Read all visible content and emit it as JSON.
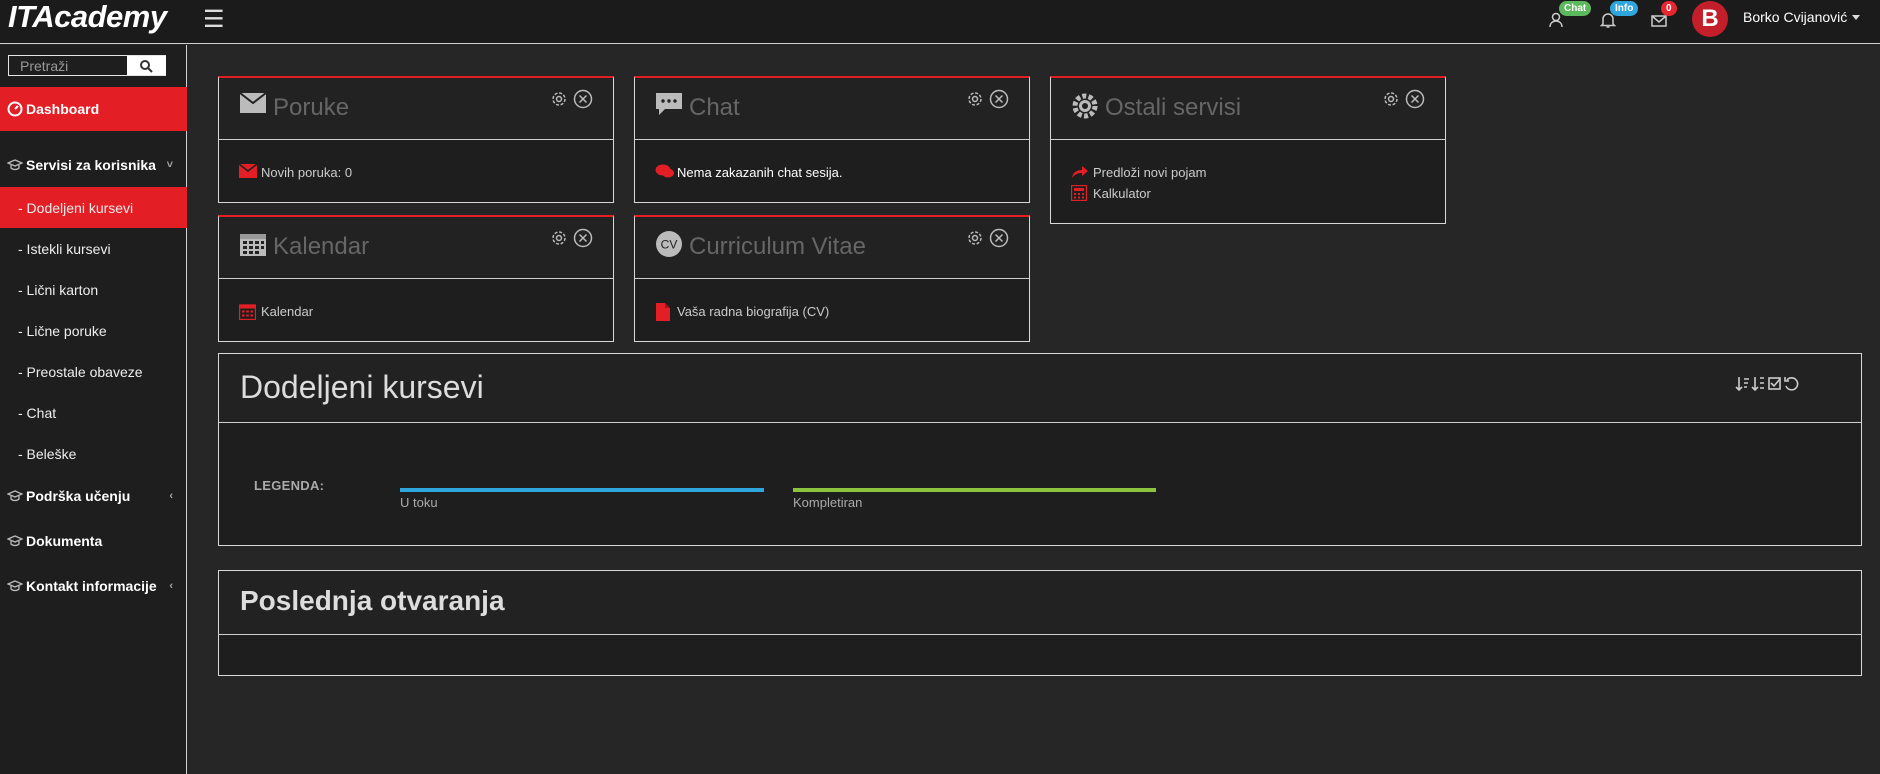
{
  "app": {
    "title": "ITAcademy"
  },
  "topbar": {
    "menu_icon": "hamburger-icon",
    "chat_badge": "Chat",
    "info_badge": "Info",
    "messages_badge": "0",
    "avatar_letter": "B",
    "username": "Borko Cvijanović"
  },
  "sidebar": {
    "search_placeholder": "Pretraži",
    "items": [
      {
        "label": "Dashboard",
        "icon": "dashboard-icon"
      },
      {
        "label": "Servisi za korisnika",
        "icon": "graduation-cap-icon"
      },
      {
        "label": "- Dodeljeni kursevi"
      },
      {
        "label": "- Istekli kursevi"
      },
      {
        "label": "- Lični karton"
      },
      {
        "label": "- Lične poruke"
      },
      {
        "label": "- Preostale obaveze"
      },
      {
        "label": "- Chat"
      },
      {
        "label": "- Beleške"
      },
      {
        "label": "Podrška učenju",
        "icon": "graduation-cap-icon"
      },
      {
        "label": "Dokumenta",
        "icon": "graduation-cap-icon"
      },
      {
        "label": "Kontakt informacije",
        "icon": "graduation-cap-icon"
      }
    ]
  },
  "widgets": {
    "poruke": {
      "title": "Poruke",
      "lines": [
        "Novih poruka: 0"
      ]
    },
    "chat": {
      "title": "Chat",
      "lines": [
        "Nema zakazanih chat sesija."
      ]
    },
    "ostali": {
      "title": "Ostali servisi",
      "lines": [
        "Predloži novi pojam",
        "Kalkulator"
      ]
    },
    "kalendar": {
      "title": "Kalendar",
      "lines": [
        "Kalendar"
      ]
    },
    "cv": {
      "title": "Curriculum Vitae",
      "icon_text": "CV",
      "lines": [
        "Vaša radna biografija (CV)"
      ]
    }
  },
  "courses": {
    "title": "Dodeljeni kursevi",
    "legend_label": "LEGENDA:",
    "legend": [
      {
        "label": "U toku",
        "color": "#2ea6dd"
      },
      {
        "label": "Kompletiran",
        "color": "#8cc43f"
      }
    ]
  },
  "recent": {
    "title": "Poslednja otvaranja"
  },
  "colors": {
    "accent": "#e41e25",
    "background": "#262626"
  }
}
